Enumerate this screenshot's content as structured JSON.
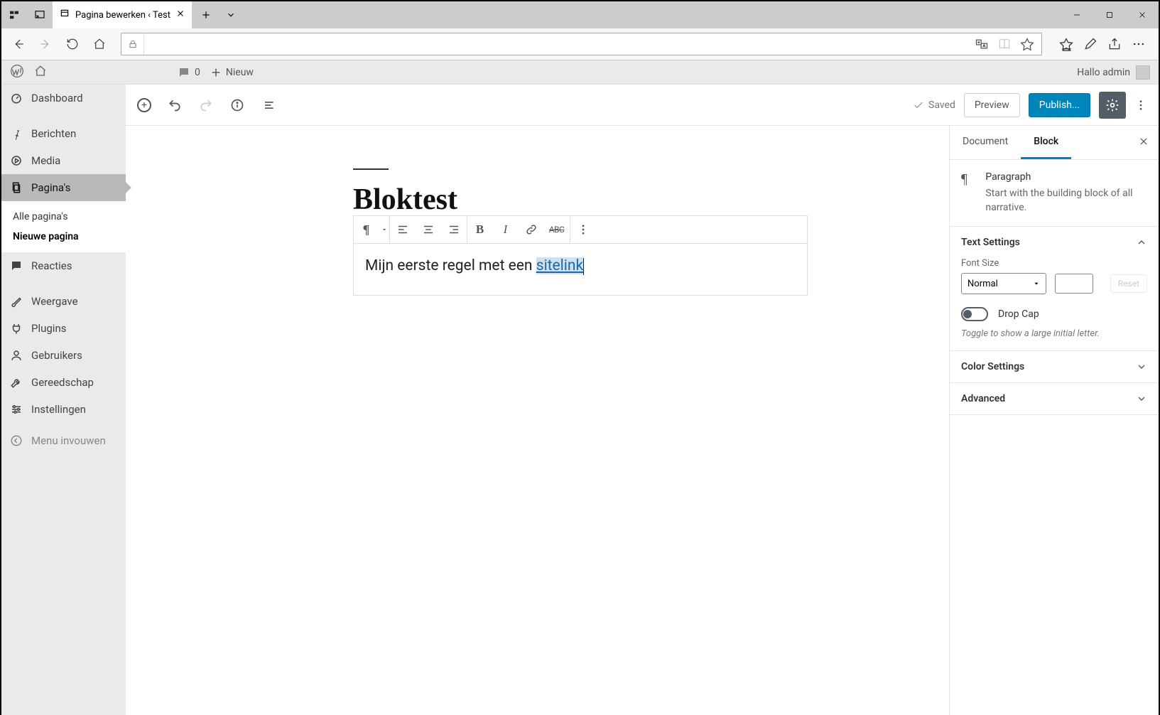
{
  "browser": {
    "tab_title": "Pagina bewerken ‹ Test"
  },
  "adminbar": {
    "comment_count": "0",
    "new_label": "Nieuw",
    "greeting": "Hallo admin"
  },
  "sidebar": {
    "dashboard": "Dashboard",
    "posts": "Berichten",
    "media": "Media",
    "pages": "Pagina's",
    "pages_sub_all": "Alle pagina's",
    "pages_sub_new": "Nieuwe pagina",
    "comments": "Reacties",
    "appearance": "Weergave",
    "plugins": "Plugins",
    "users": "Gebruikers",
    "tools": "Gereedschap",
    "settings": "Instellingen",
    "collapse": "Menu invouwen"
  },
  "editor": {
    "saved": "Saved",
    "preview": "Preview",
    "publish": "Publish...",
    "title": "Bloktest",
    "paragraph_text": "Mijn eerste regel met een ",
    "paragraph_link": "sitelink"
  },
  "inspector": {
    "tab_document": "Document",
    "tab_block": "Block",
    "block_name": "Paragraph",
    "block_desc": "Start with the building block of all narrative.",
    "text_settings": "Text Settings",
    "font_size_label": "Font Size",
    "font_size_value": "Normal",
    "reset": "Reset",
    "drop_cap": "Drop Cap",
    "drop_cap_hint": "Toggle to show a large initial letter.",
    "color_settings": "Color Settings",
    "advanced": "Advanced"
  }
}
